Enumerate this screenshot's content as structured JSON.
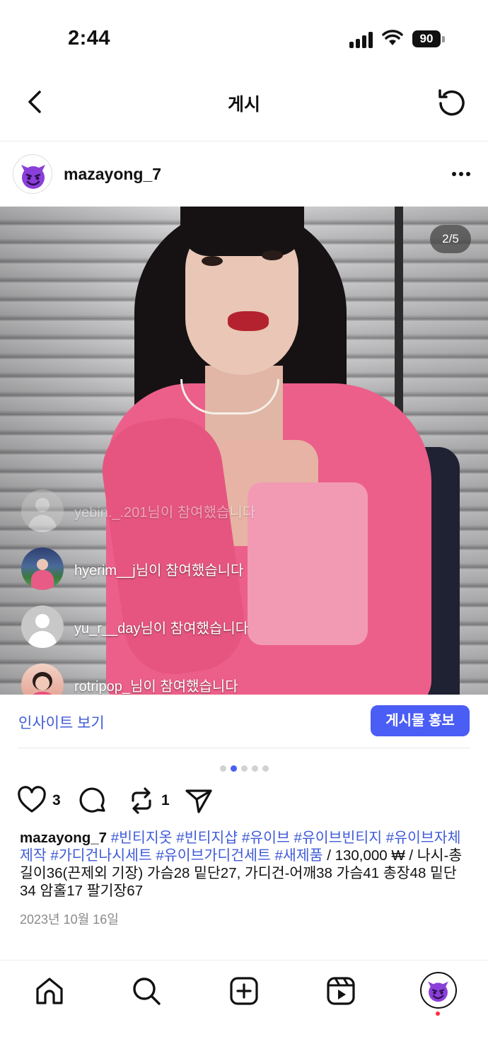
{
  "status": {
    "time": "2:44",
    "battery": "90"
  },
  "header": {
    "title": "게시"
  },
  "post": {
    "author": "mazayong_7",
    "media_counter": "2/5",
    "joins": [
      {
        "name": "yebin._.201님이 참여했습니다"
      },
      {
        "name": "hyerim__j님이 참여했습니다"
      },
      {
        "name": "yu_r__day님이 참여했습니다"
      },
      {
        "name": "rotripop_님이 참여했습니다"
      }
    ],
    "insight_label": "인사이트 보기",
    "promote_label": "게시물 홍보",
    "carousel": {
      "total": 5,
      "active": 2
    },
    "likes": "3",
    "reposts": "1",
    "caption": {
      "user": "mazayong_7",
      "tags_line": "#빈티지옷 #빈티지샵 #유이브 #유이브빈티지 #유이브자체제작 #가디건나시세트 #유이브가디건세트 #새제품",
      "body": " / 130,000 ₩ / 나시-총길이36(끈제외 기장) 가슴28 밑단27, 가디건-어깨38 가슴41 총장48 밑단34 암홀17 팔기장67"
    },
    "date": "2023년 10월 16일"
  },
  "colors": {
    "accent": "#4a5df5",
    "link": "#3f5bd8",
    "notification": "#ff2d45"
  },
  "icons": {
    "back": "chevron-left-icon",
    "refresh": "refresh-icon",
    "more": "more-horizontal-icon",
    "like": "heart-icon",
    "comment": "comment-icon",
    "repost": "repost-icon",
    "share": "send-icon",
    "home": "home-icon",
    "search": "search-icon",
    "create": "plus-square-icon",
    "reels": "reels-icon",
    "profile": "devil-emoji-avatar"
  }
}
